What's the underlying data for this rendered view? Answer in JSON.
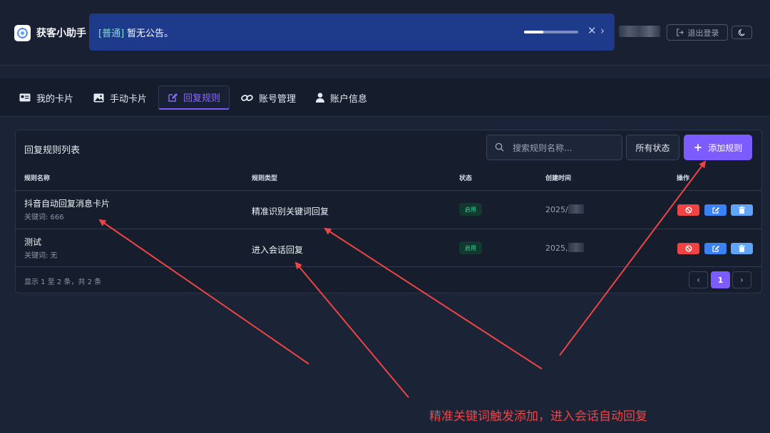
{
  "header": {
    "brand": "获客小助手",
    "notice_tag": "[普通]",
    "notice_text": "暂无公告。",
    "notice_progress": 0.35,
    "logout_label": "退出登录",
    "icons": [
      "logo-icon",
      "close-icon",
      "chevron-right-icon",
      "logout-icon",
      "moon-icon"
    ]
  },
  "nav": {
    "tabs": [
      {
        "label": "我的卡片",
        "icon": "card-icon"
      },
      {
        "label": "手动卡片",
        "icon": "image-icon"
      },
      {
        "label": "回复规则",
        "icon": "edit-icon",
        "active": true
      },
      {
        "label": "账号管理",
        "icon": "link-icon"
      },
      {
        "label": "账户信息",
        "icon": "user-icon"
      }
    ]
  },
  "list": {
    "title": "回复规则列表",
    "search_placeholder": "搜索规则名称...",
    "status_filter": "所有状态",
    "add_label": "添加规则",
    "columns": [
      "规则名称",
      "规则类型",
      "状态",
      "创建时间",
      "操作"
    ],
    "rows": [
      {
        "name": "抖音自动回复消息卡片",
        "keyword": "关键词: 666",
        "type": "精准识别关键词回复",
        "status": "启用",
        "created": "2025/"
      },
      {
        "name": "测试",
        "keyword": "关键词: 无",
        "type": "进入会话回复",
        "status": "启用",
        "created": "2025,"
      }
    ],
    "summary": "显示 1 至 2 条，共 2 条",
    "pagination": {
      "prev": "‹",
      "current": "1",
      "next": "›"
    }
  },
  "annotation": {
    "text": "精准关键词触发添加，进入会话自动回复",
    "color": "#ef4444"
  },
  "colors": {
    "accent": "#7c5cff",
    "notice_bg": "#1e3a8a",
    "success": "#34d399",
    "danger": "#ef4444",
    "info": "#3b82f6"
  }
}
